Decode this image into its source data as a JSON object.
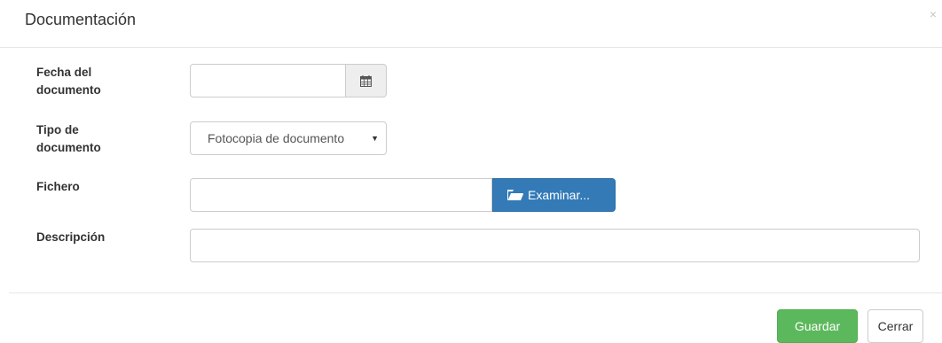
{
  "modal": {
    "title": "Documentación",
    "close_glyph": "×"
  },
  "form": {
    "fecha": {
      "label_line1": "Fecha del",
      "label_line2": "documento",
      "value": "",
      "addon_icon": "calendar-icon"
    },
    "tipo": {
      "label_line1": "Tipo de",
      "label_line2": "documento",
      "selected": "Fotocopia de documento",
      "caret": "▼"
    },
    "fichero": {
      "label": "Fichero",
      "value": "",
      "browse_label": "Examinar...",
      "browse_icon": "folder-open-icon"
    },
    "descripcion": {
      "label": "Descripción",
      "value": ""
    }
  },
  "footer": {
    "save_label": "Guardar",
    "close_label": "Cerrar"
  },
  "colors": {
    "primary": "#337ab7",
    "success": "#5cb85c",
    "border": "#cccccc"
  }
}
